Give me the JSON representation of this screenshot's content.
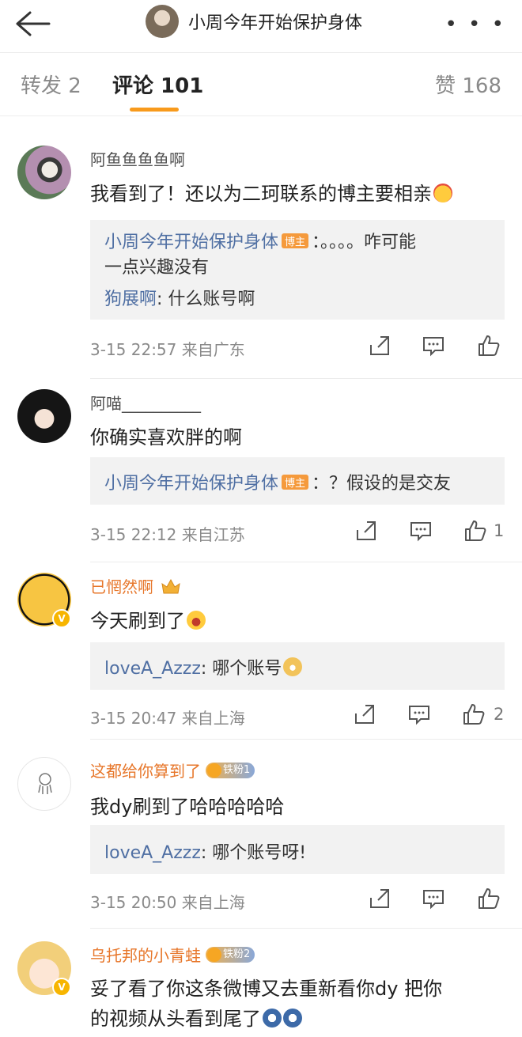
{
  "header": {
    "title": "小周今年开始保护身体",
    "more": "• • •"
  },
  "tabs": {
    "repost": "转发 2",
    "comment": "评论 101",
    "likes": "赞 168"
  },
  "comments": [
    {
      "user": "阿鱼鱼鱼鱼啊",
      "text": "我看到了！还以为二珂联系的博主要相亲",
      "replies": [
        {
          "name": "小周今年开始保护身体",
          "tag": "博主",
          "body": "：。。。。咋可能",
          "body2": "一点兴趣没有"
        },
        {
          "name": "狗展啊",
          "body": ": 什么账号啊"
        }
      ],
      "meta": "3-15 22:57 来自广东",
      "likes": ""
    },
    {
      "user": "阿喵__________",
      "text": "你确实喜欢胖的啊",
      "replies": [
        {
          "name": "小周今年开始保护身体",
          "tag": "博主",
          "body": "：？假设的是交友"
        }
      ],
      "meta": "3-15 22:12 来自江苏",
      "likes": "1"
    },
    {
      "user": "已惘然啊",
      "text": "今天刷到了",
      "replies": [
        {
          "name": "loveA_Azzz",
          "body": ": 哪个账号"
        }
      ],
      "meta": "3-15 20:47 来自上海",
      "likes": "2"
    },
    {
      "user": "这都给你算到了",
      "fan_badge": "铁粉1",
      "text": "我dy刷到了哈哈哈哈哈",
      "replies": [
        {
          "name": "loveA_Azzz",
          "body": ": 哪个账号呀!"
        }
      ],
      "meta": "3-15 20:50 来自上海",
      "likes": ""
    },
    {
      "user": "乌托邦的小青蛙",
      "fan_badge": "铁粉2",
      "text": "妥了看了你这条微博又去重新看你dy 把你",
      "text2": "的视频从头看到尾了"
    }
  ],
  "icons": {
    "back": "arrow-left-icon",
    "share": "share-icon",
    "reply": "comment-icon",
    "like": "thumb-up-icon",
    "verified": "verified-icon"
  },
  "colors": {
    "accent": "#f89a1c",
    "link": "#4f6fa3",
    "orange_name": "#e7772b",
    "reply_bg": "#f2f2f2"
  }
}
